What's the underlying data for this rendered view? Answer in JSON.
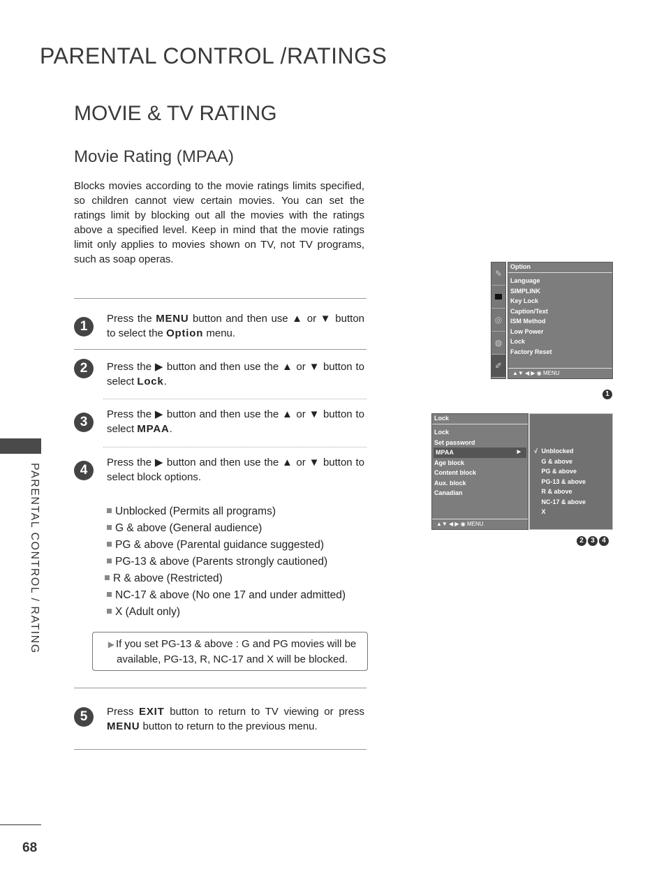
{
  "header": {
    "main_title": "PARENTAL CONTROL /RATINGS",
    "section_title": "MOVIE & TV RATING",
    "sub_title": "Movie Rating (MPAA)"
  },
  "intro": "Blocks movies according to the movie ratings limits specified, so children cannot view certain movies. You can set the ratings limit by blocking out all the movies with the ratings above a specified level. Keep in mind that the movie ratings limit only applies to movies shown on TV, not TV programs, such as soap operas.",
  "side": {
    "label": "PARENTAL CONTROL / RATING",
    "page_number": "68"
  },
  "steps": [
    {
      "num": "1",
      "pre": "Press the ",
      "kw1": "MENU",
      "mid": " button and then use ▲ or ▼ button to select the ",
      "kw2": "Option",
      "post": " menu."
    },
    {
      "num": "2",
      "pre": "Press the ▶ button and then use the ▲ or ▼ button to select ",
      "kw1": "Lock",
      "post": "."
    },
    {
      "num": "3",
      "pre": "Press the ▶ button and then use the ▲ or ▼ button to select  ",
      "kw1": "MPAA",
      "post": "."
    },
    {
      "num": "4",
      "text": "Press the ▶ button and then use the ▲ or ▼ button to select block options."
    },
    {
      "num": "5",
      "pre": "Press ",
      "kw1": "EXIT",
      "mid": " button to return to TV viewing or press ",
      "kw2": "MENU",
      "post": " button to return to the previous menu."
    }
  ],
  "block_options": [
    "Unblocked (Permits all programs)",
    "G & above (General audience)",
    "PG & above (Parental guidance suggested)",
    "PG-13  & above (Parents strongly cautioned)",
    "R & above (Restricted)",
    "NC-17 & above (No one 17 and under admitted)",
    "X (Adult only)"
  ],
  "note": "If you set PG-13 & above : G and PG movies will be available, PG-13, R, NC-17 and X will be blocked.",
  "osd_option": {
    "title": "Option",
    "items": [
      "Language",
      "SIMPLINK",
      "Key Lock",
      "Caption/Text",
      "ISM Method",
      "Low Power",
      "Lock",
      "Factory Reset"
    ],
    "footer": "▲▼  ◀ ▶  ◉  MENU",
    "badge": "1"
  },
  "osd_lock": {
    "title": "Lock",
    "items": [
      "Lock",
      "Set password",
      "MPAA",
      "Age block",
      "Content block",
      "Aux. block",
      "Canadian"
    ],
    "selected": "MPAA",
    "footer": "▲▼  ◀ ▶  ◉  MENU",
    "check": "√",
    "sub_items": [
      "Unblocked",
      "G &  above",
      "PG &  above",
      "PG-13 &  above",
      "R &  above",
      "NC-17 &  above",
      "X"
    ],
    "checked": "Unblocked",
    "badges": [
      "2",
      "3",
      "4"
    ]
  }
}
